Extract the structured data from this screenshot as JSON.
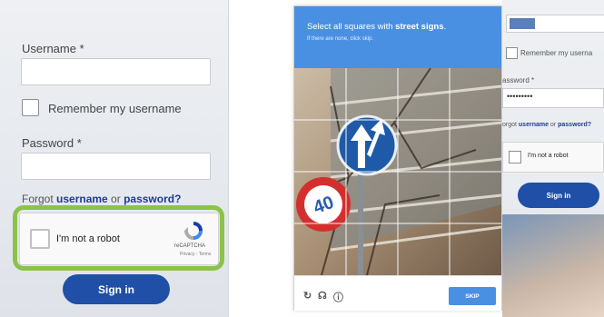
{
  "login": {
    "username_label": "Username *",
    "remember_label": "Remember my username",
    "password_label": "Password *",
    "forgot_prefix": "Forgot ",
    "forgot_username": "username",
    "forgot_or": " or ",
    "forgot_password": "password?",
    "signin_label": "Sign in"
  },
  "recaptcha": {
    "checkbox_label": "I'm not a robot",
    "brand": "reCAPTCHA",
    "links": "Privacy - Terms"
  },
  "challenge": {
    "title_prefix": "Select all squares with ",
    "title_emphasis": "street signs",
    "title_suffix": ".",
    "subtitle": "If there are none, click skip.",
    "reload_icon": "↻",
    "audio_icon": "☊",
    "info_icon": "ⓘ",
    "skip_label": "SKIP",
    "sign_number": "40",
    "header_color": "#4a90e2"
  },
  "right_login": {
    "remember_label": "Remember my userna",
    "password_label": "assword *",
    "password_value": "•••••••••",
    "forgot_prefix": "orgot ",
    "forgot_username": "username",
    "forgot_or": " or ",
    "forgot_password": "password?",
    "recaptcha_label": "I'm not a robot",
    "signin_label": "Sign in"
  },
  "colors": {
    "accent_green": "#8bc34a",
    "primary_blue": "#1f4fa7"
  }
}
